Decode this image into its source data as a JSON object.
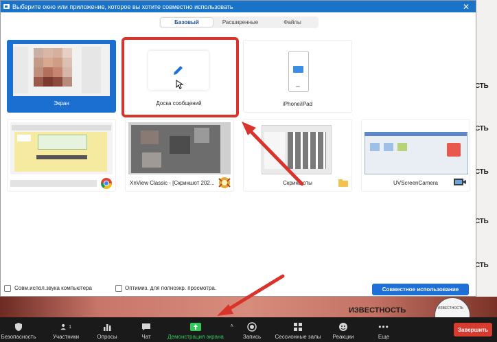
{
  "dialog": {
    "title": "Выберите окно или приложение, которое вы хотите совместно использовать",
    "close_glyph": "✕",
    "tabs": [
      {
        "label": "Базовый",
        "active": true
      },
      {
        "label": "Расширенные",
        "active": false
      },
      {
        "label": "Файлы",
        "active": false
      }
    ],
    "tiles": {
      "screen": "Экран",
      "whiteboard": "Доска сообщений",
      "iphone": "iPhone/iPad",
      "chrome_window": "",
      "xnview": "XnView Classic - [Скриншот 202...",
      "screenshots": "Скриншоты",
      "uvscreencamera": "UVScreenCamera"
    },
    "share_sound_label": "Совм.испол.звука компьютера",
    "optimize_label": "Оптимиз. для полноэкр. просмотра.",
    "share_button": "Совместное использование"
  },
  "background": {
    "right_text": [
      "СТЬ",
      "СТЬ",
      "СТЬ",
      "СТЬ",
      "СТЬ"
    ],
    "overlay_text": "ИЗВЕСТНОСТЬ",
    "logo_text": "ИЗВЕСТНОСТЬ"
  },
  "toolbar": {
    "items": [
      {
        "label": "Безопасность",
        "icon": "shield-icon"
      },
      {
        "label": "Участники",
        "icon": "participants-icon",
        "count": "1"
      },
      {
        "label": "Опросы",
        "icon": "polls-icon"
      },
      {
        "label": "Чат",
        "icon": "chat-icon"
      },
      {
        "label": "Демонстрация экрана",
        "icon": "share-screen-icon"
      },
      {
        "label": "Запись",
        "icon": "record-icon"
      },
      {
        "label": "Сессионные залы",
        "icon": "breakout-rooms-icon"
      },
      {
        "label": "Реакции",
        "icon": "reactions-icon"
      },
      {
        "label": "Еще",
        "icon": "more-icon"
      }
    ],
    "end_button": "Завершить"
  },
  "colors": {
    "accent": "#1e6fd6",
    "highlight_frame": "#d9342b",
    "end_button": "#d53b2f",
    "share_active": "#32c85a"
  }
}
